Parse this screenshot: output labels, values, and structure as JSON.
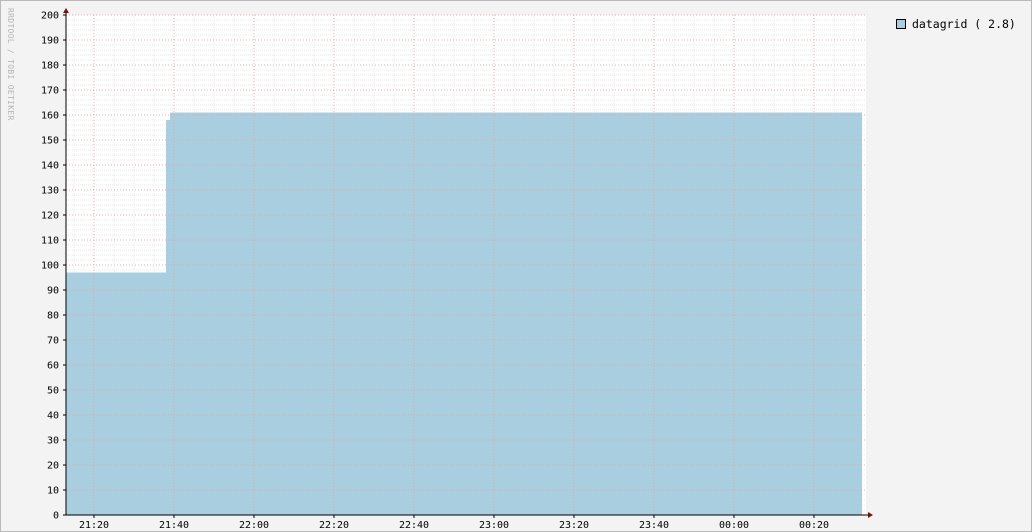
{
  "watermark": "RRDTOOL / TOBI OETIKER",
  "chart_data": {
    "type": "area",
    "title": "",
    "xlabel": "",
    "ylabel": "",
    "ylim": [
      0,
      200
    ],
    "yticks": [
      0,
      10,
      20,
      30,
      40,
      50,
      60,
      70,
      80,
      90,
      100,
      110,
      120,
      130,
      140,
      150,
      160,
      170,
      180,
      190,
      200
    ],
    "xlim": [
      "21:13",
      "00:33"
    ],
    "xticks": [
      "21:20",
      "21:40",
      "22:00",
      "22:20",
      "22:40",
      "23:00",
      "23:20",
      "23:40",
      "00:00",
      "00:20"
    ],
    "grid": true,
    "legend_position": "top-right",
    "series": [
      {
        "name": "datagrid",
        "legend_text": "datagrid ( 2.8)",
        "color": "#a8cee0",
        "points": [
          {
            "x": "21:13",
            "y": 97
          },
          {
            "x": "21:38",
            "y": 97
          },
          {
            "x": "21:38",
            "y": 158
          },
          {
            "x": "21:39",
            "y": 158
          },
          {
            "x": "21:39",
            "y": 161
          },
          {
            "x": "00:32",
            "y": 161
          }
        ]
      }
    ]
  },
  "colors": {
    "background": "#f3f3f3",
    "canvas": "#ffffff",
    "grid_major": "#e3a3a3",
    "grid_minor": "#e8e8e8",
    "axis": "#000000",
    "arrow": "#7a1010"
  }
}
